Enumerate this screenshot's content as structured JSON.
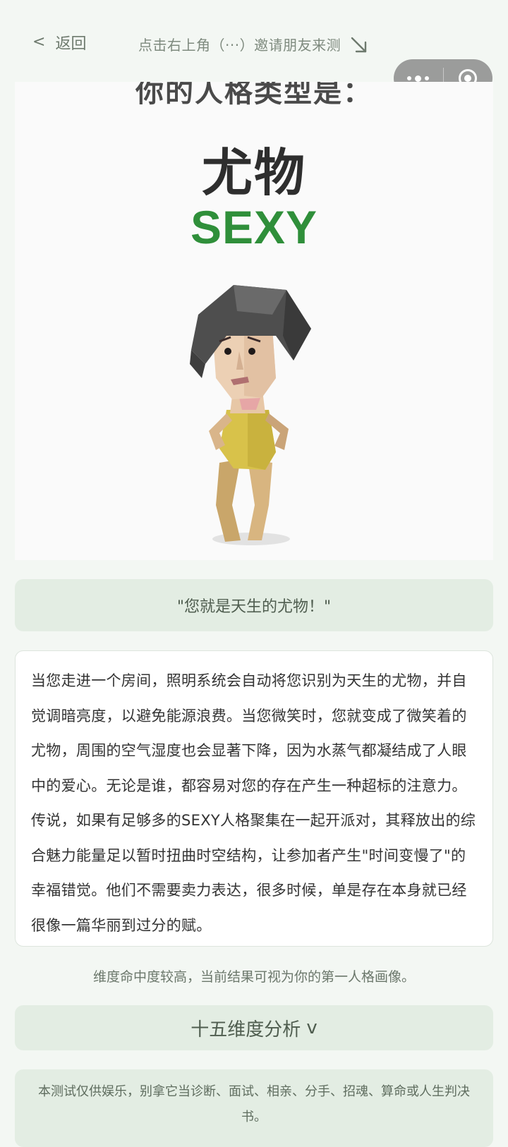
{
  "topbar": {
    "back_icon": "chevron-left-icon",
    "back_label": "返回",
    "share_hint": "点击右上角（···）邀请朋友来测",
    "arrow_icon": "arrow-down-right-icon",
    "capsule": {
      "more_icon": "more-dots-icon",
      "close_icon": "target-circle-icon"
    }
  },
  "result": {
    "headline": "你的人格类型是：",
    "type_cn": "尤物",
    "type_en": "SEXY",
    "type_en_color": "#2f8f3a"
  },
  "quote": "\"您就是天生的尤物！\"",
  "description": "当您走进一个房间，照明系统会自动将您识别为天生的尤物，并自觉调暗亮度，以避免能源浪费。当您微笑时，您就变成了微笑着的尤物，周围的空气湿度也会显著下降，因为水蒸气都凝结成了人眼中的爱心。无论是谁，都容易对您的存在产生一种超标的注意力。传说，如果有足够多的SEXY人格聚集在一起开派对，其释放出的综合魅力能量足以暂时扭曲时空结构，让参加者产生\"时间变慢了\"的幸福错觉。他们不需要卖力表达，很多时候，单是存在本身就已经很像一篇华丽到过分的赋。",
  "note": "维度命中度较高，当前结果可视为你的第一人格画像。",
  "dimension_button": {
    "label": "十五维度分析",
    "icon": "chevron-down-icon",
    "icon_text": "v"
  },
  "disclaimer": "本测试仅供娱乐，别拿它当诊断、面试、相亲、分手、招魂、算命或人生判决书。",
  "colors": {
    "background": "#f3f7f3",
    "panel": "#e3ede3",
    "accent_green": "#2f8f3a"
  }
}
